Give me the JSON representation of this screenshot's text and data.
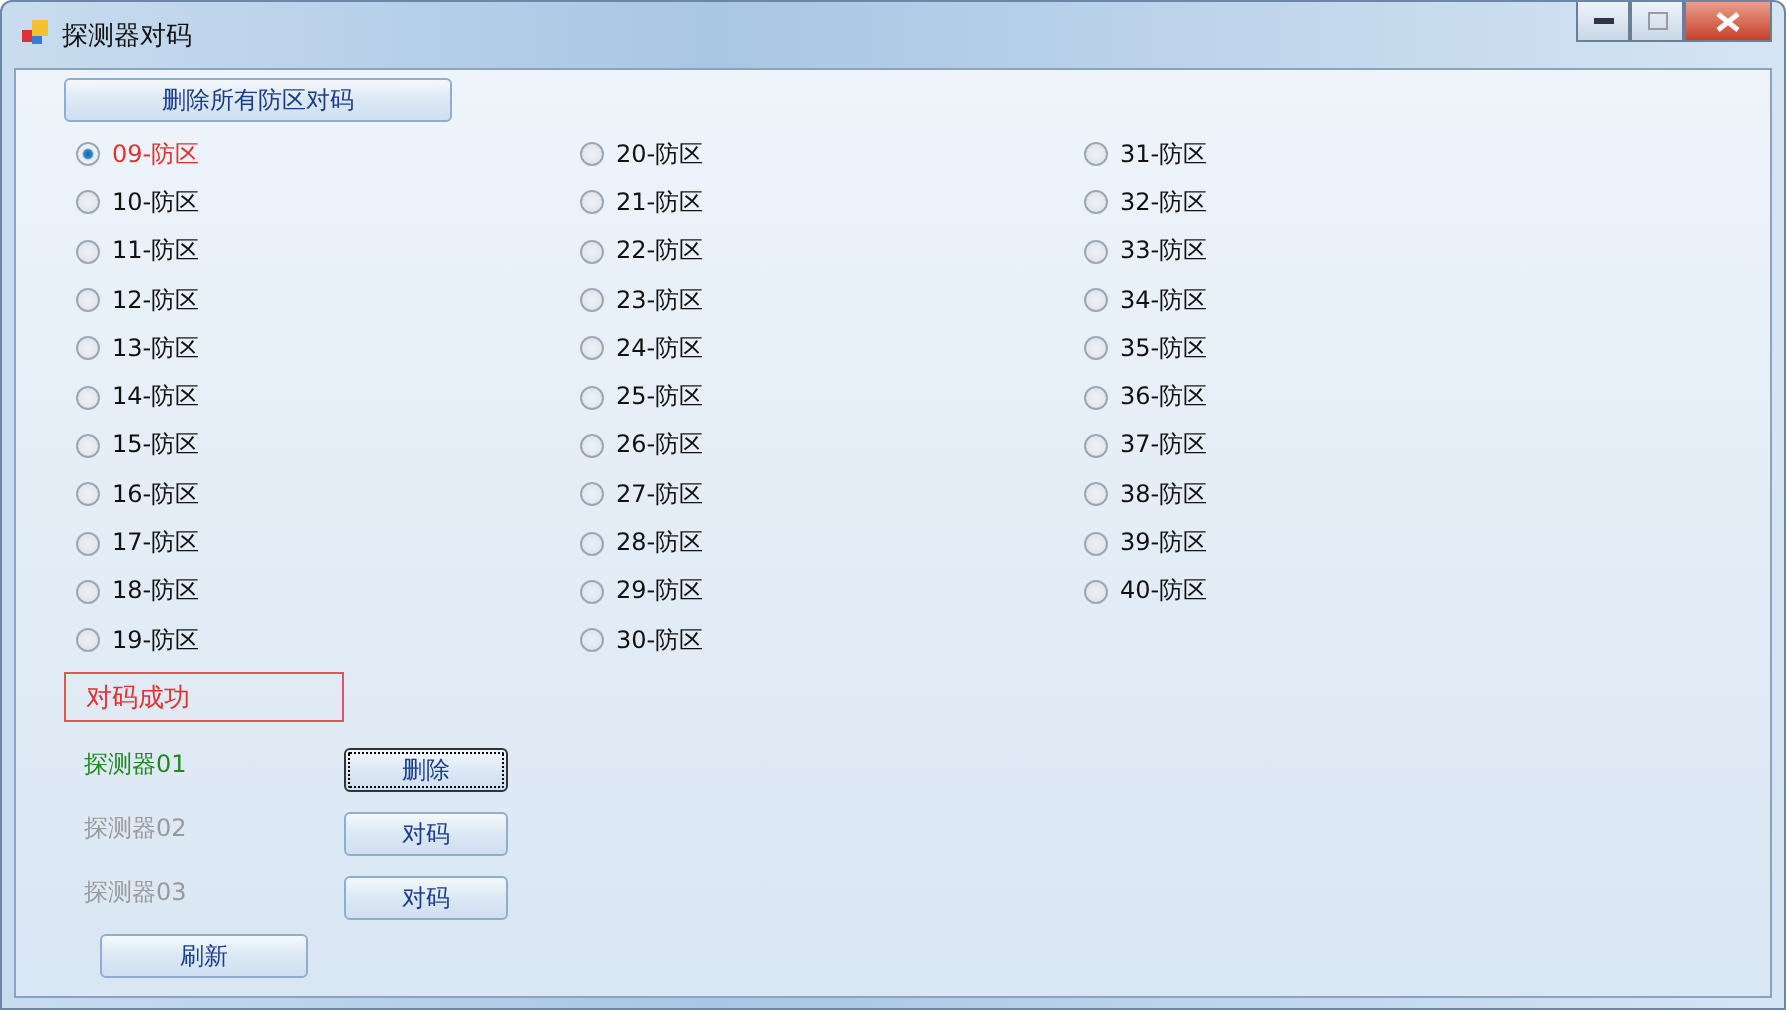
{
  "window": {
    "title": "探测器对码"
  },
  "clear_all_button": "删除所有防区对码",
  "zones": [
    {
      "label": "09-防区",
      "selected": true
    },
    {
      "label": "10-防区",
      "selected": false
    },
    {
      "label": "11-防区",
      "selected": false
    },
    {
      "label": "12-防区",
      "selected": false
    },
    {
      "label": "13-防区",
      "selected": false
    },
    {
      "label": "14-防区",
      "selected": false
    },
    {
      "label": "15-防区",
      "selected": false
    },
    {
      "label": "16-防区",
      "selected": false
    },
    {
      "label": "17-防区",
      "selected": false
    },
    {
      "label": "18-防区",
      "selected": false
    },
    {
      "label": "19-防区",
      "selected": false
    },
    {
      "label": "20-防区",
      "selected": false
    },
    {
      "label": "21-防区",
      "selected": false
    },
    {
      "label": "22-防区",
      "selected": false
    },
    {
      "label": "23-防区",
      "selected": false
    },
    {
      "label": "24-防区",
      "selected": false
    },
    {
      "label": "25-防区",
      "selected": false
    },
    {
      "label": "26-防区",
      "selected": false
    },
    {
      "label": "27-防区",
      "selected": false
    },
    {
      "label": "28-防区",
      "selected": false
    },
    {
      "label": "29-防区",
      "selected": false
    },
    {
      "label": "30-防区",
      "selected": false
    },
    {
      "label": "31-防区",
      "selected": false
    },
    {
      "label": "32-防区",
      "selected": false
    },
    {
      "label": "33-防区",
      "selected": false
    },
    {
      "label": "34-防区",
      "selected": false
    },
    {
      "label": "35-防区",
      "selected": false
    },
    {
      "label": "36-防区",
      "selected": false
    },
    {
      "label": "37-防区",
      "selected": false
    },
    {
      "label": "38-防区",
      "selected": false
    },
    {
      "label": "39-防区",
      "selected": false
    },
    {
      "label": "40-防区",
      "selected": false
    }
  ],
  "status": "对码成功",
  "detectors": [
    {
      "name": "探测器01",
      "paired": true,
      "action": "删除"
    },
    {
      "name": "探测器02",
      "paired": false,
      "action": "对码"
    },
    {
      "name": "探测器03",
      "paired": false,
      "action": "对码"
    }
  ],
  "refresh_button": "刷新"
}
